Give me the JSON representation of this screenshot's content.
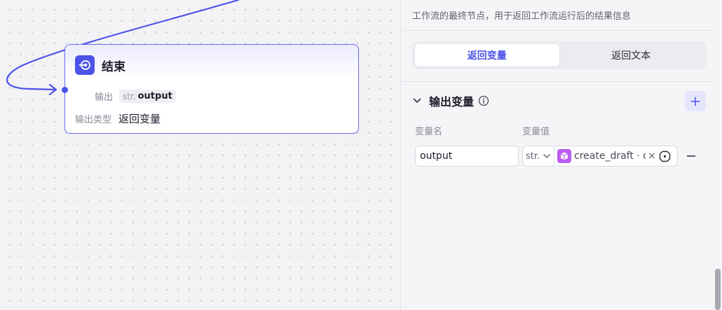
{
  "colors": {
    "accent": "#4d53e8",
    "node_border": "#6d6df0",
    "plugin_icon": "#b95cf0"
  },
  "node": {
    "title": "结束",
    "icon": "exit-icon",
    "output_label": "输出",
    "output_type": "str.",
    "output_name": "output",
    "output_kind_label": "输出类型",
    "output_kind_value": "返回变量"
  },
  "panel": {
    "description": "工作流的最终节点，用于返回工作流运行后的结果信息",
    "tabs": [
      {
        "label": "返回变量",
        "active": true
      },
      {
        "label": "返回文本",
        "active": false
      }
    ],
    "section": {
      "title": "输出变量",
      "col_name": "变量名",
      "col_value": "变量值",
      "rows": [
        {
          "name": "output",
          "type": "str.",
          "ref_icon": "cube-icon",
          "ref_text": "create_draft · d"
        }
      ]
    }
  }
}
